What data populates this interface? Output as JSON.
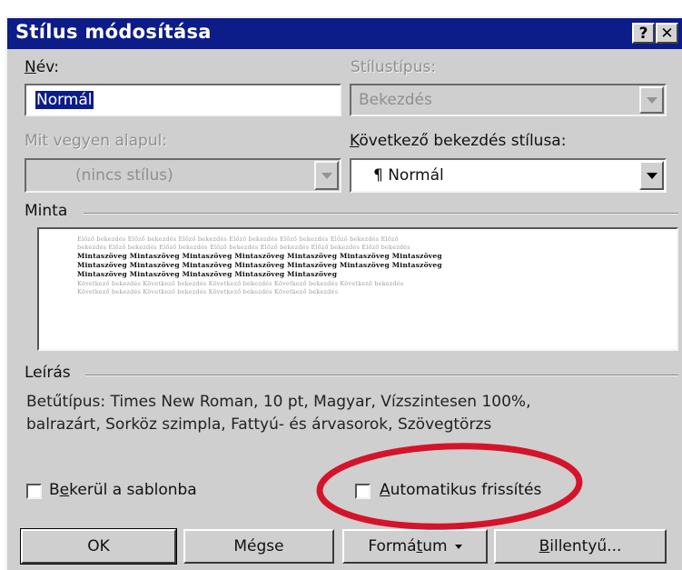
{
  "dialog": {
    "title": "Stílus módosítása",
    "help_label": "?",
    "close_label": "✕"
  },
  "name_field": {
    "label_key": "N",
    "label_rest": "év:",
    "value": "Normál"
  },
  "style_type": {
    "label": "Stílustípus:",
    "value": "Bekezdés"
  },
  "based_on": {
    "label": "Mit vegyen alapul:",
    "value": "(nincs stílus)"
  },
  "next_style": {
    "label_key": "K",
    "label_rest": "övetkező bekezdés stílusa:",
    "value": "¶ Normál"
  },
  "preview": {
    "label": "Minta",
    "prev_lines": [
      "Előző bekezdés Előző bekezdés Előző bekezdés Előző bekezdés Előző bekezdés Előző bekezdés Előző",
      "bekezdés Előző bekezdés Előző bekezdés Előző bekezdés Előző bekezdés Előző bekezdés Előző bekezdés"
    ],
    "cur_lines": [
      "Mintaszöveg Mintaszöveg Mintaszöveg Mintaszöveg Mintaszöveg Mintaszöveg Mintaszöveg",
      "Mintaszöveg Mintaszöveg Mintaszöveg Mintaszöveg Mintaszöveg Mintaszöveg Mintaszöveg",
      "Mintaszöveg Mintaszöveg Mintaszöveg Mintaszöveg Mintaszöveg"
    ],
    "next_lines": [
      "Következő bekezdés Következő bekezdés Következő bekezdés Következő bekezdés Következő bekezdés",
      "Következő bekezdés Következő bekezdés Következő bekezdés Következő bekezdés"
    ]
  },
  "description": {
    "label": "Leírás",
    "line1": "Betűtípus: Times New Roman, 10 pt, Magyar, Vízszintesen 100%,",
    "line2": "balrazárt, Sorköz szimpla, Fattyú- és árvasorok, Szövegtörzs"
  },
  "checkboxes": {
    "template_pre": "B",
    "template_key": "e",
    "template_rest": "kerül a sablonba",
    "auto_key": "A",
    "auto_rest": "utomatikus frissítés"
  },
  "buttons": {
    "ok": "OK",
    "cancel": "Mégse",
    "format_pre": "Formá",
    "format_key": "t",
    "format_rest": "um",
    "shortcut_key": "B",
    "shortcut_rest": "illentyű..."
  },
  "colors": {
    "titlebar": "#0c1c88",
    "dialog_face": "#cfcfcf",
    "annotation": "#d4142a"
  }
}
